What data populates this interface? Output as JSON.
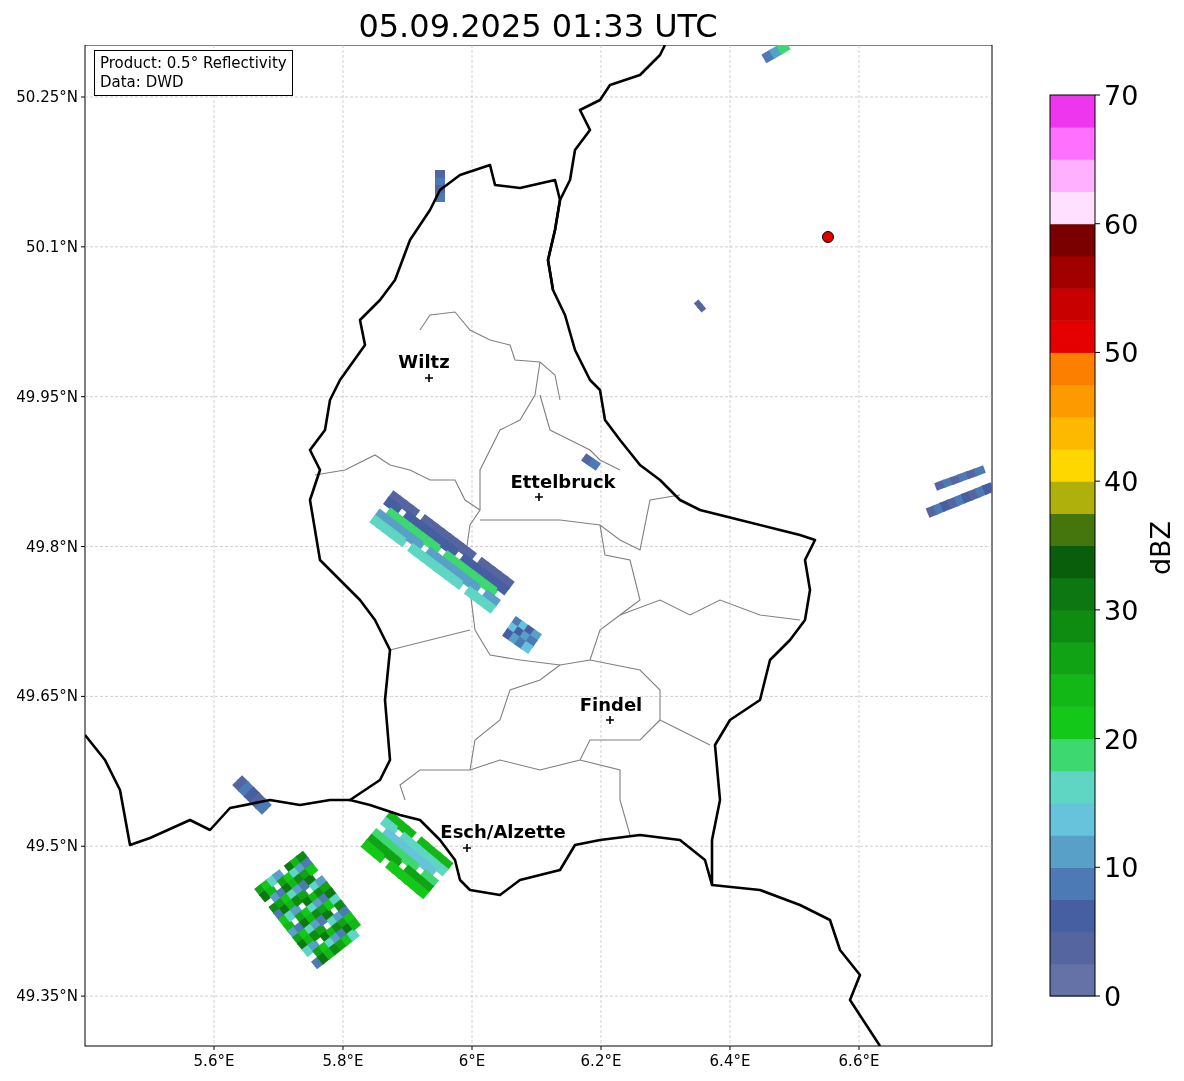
{
  "title": "05.09.2025 01:33 UTC",
  "info_box": {
    "lines": [
      "Product: 0.5° Reflectivity",
      "Data: DWD"
    ]
  },
  "map": {
    "lat_ticks": [
      "50.25°N",
      "50.1°N",
      "49.95°N",
      "49.8°N",
      "49.65°N",
      "49.5°N",
      "49.35°N"
    ],
    "lon_ticks": [
      "5.6°E",
      "5.8°E",
      "6°E",
      "6.2°E",
      "6.4°E",
      "6.6°E"
    ],
    "cities": [
      {
        "name": "Wiltz"
      },
      {
        "name": "Ettelbruck"
      },
      {
        "name": "Findel"
      },
      {
        "name": "Esch/Alzette"
      }
    ]
  },
  "colorbar": {
    "label": "dBZ",
    "ticks": [
      "70",
      "60",
      "50",
      "40",
      "30",
      "20",
      "10",
      "0"
    ],
    "bins": [
      {
        "color": "#6572a8"
      },
      {
        "color": "#5565a0"
      },
      {
        "color": "#465ea2"
      },
      {
        "color": "#4b7ab5"
      },
      {
        "color": "#58a0c8"
      },
      {
        "color": "#67c3dc"
      },
      {
        "color": "#5fd6c4"
      },
      {
        "color": "#3ed870"
      },
      {
        "color": "#14c81a"
      },
      {
        "color": "#12b816"
      },
      {
        "color": "#10a414"
      },
      {
        "color": "#0d8c11"
      },
      {
        "color": "#0d7711"
      },
      {
        "color": "#095e0c"
      },
      {
        "color": "#45760e"
      },
      {
        "color": "#b0b00c"
      },
      {
        "color": "#fed700"
      },
      {
        "color": "#fdb800"
      },
      {
        "color": "#fd9a00"
      },
      {
        "color": "#fd7f00"
      },
      {
        "color": "#e40000"
      },
      {
        "color": "#c80000"
      },
      {
        "color": "#a20000"
      },
      {
        "color": "#7a0000"
      },
      {
        "color": "#ffe0ff"
      },
      {
        "color": "#ffb0ff"
      },
      {
        "color": "#ff70ff"
      },
      {
        "color": "#ee36ee"
      }
    ]
  }
}
